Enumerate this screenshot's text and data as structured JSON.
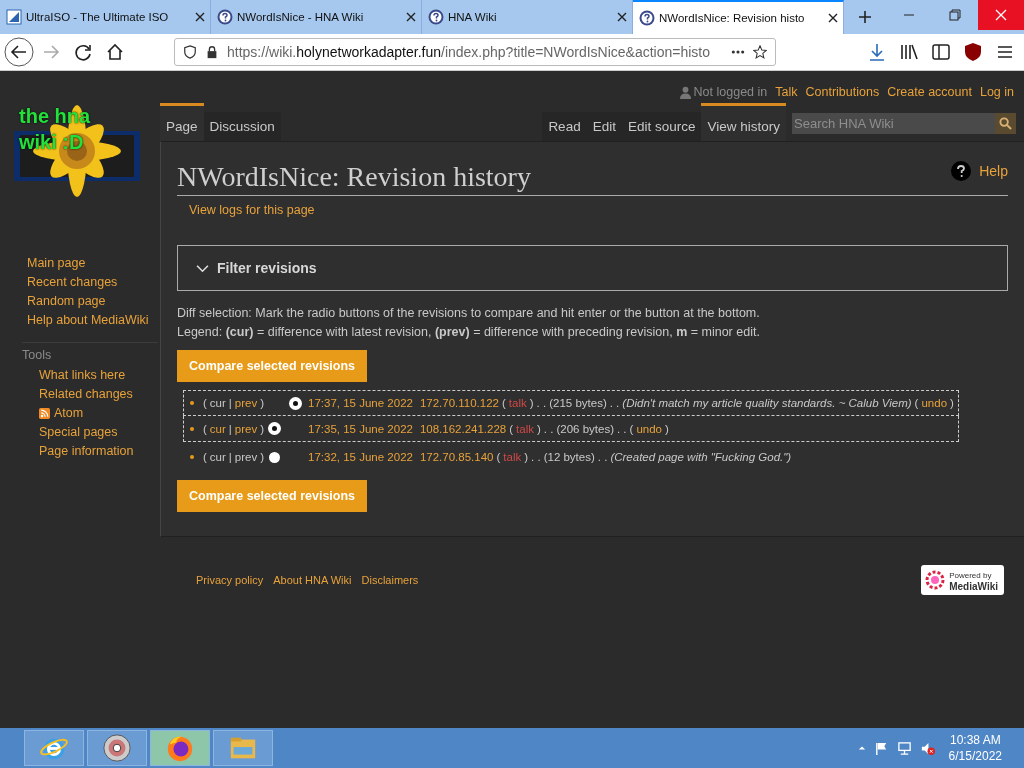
{
  "browser": {
    "tabs": [
      {
        "title": "UltraISO - The Ultimate ISO",
        "kind": "disc-app",
        "selected": false
      },
      {
        "title": "NWordIsNice - HNA Wiki",
        "kind": "wiki",
        "selected": false
      },
      {
        "title": "HNA Wiki",
        "kind": "wiki",
        "selected": false
      },
      {
        "title": "NWordIsNice: Revision histo",
        "kind": "wiki",
        "selected": true
      }
    ],
    "url_prefix": "https://wiki.",
    "url_domain": "holynetworkadapter.fun",
    "url_rest": "/index.php?title=NWordIsNice&action=histo"
  },
  "personal": {
    "status": "Not logged in",
    "links": [
      "Talk",
      "Contributions",
      "Create account",
      "Log in"
    ]
  },
  "logo": {
    "line1": "the hna",
    "line2": "wiki :D"
  },
  "sidebar": {
    "nav": [
      "Main page",
      "Recent changes",
      "Random page",
      "Help about MediaWiki"
    ],
    "tools_heading": "Tools",
    "tools": [
      {
        "label": "What links here",
        "kind": "link"
      },
      {
        "label": "Related changes",
        "kind": "link"
      },
      {
        "label": "Atom",
        "kind": "feed"
      },
      {
        "label": "Special pages",
        "kind": "link"
      },
      {
        "label": "Page information",
        "kind": "link"
      }
    ]
  },
  "namespace_tabs": [
    {
      "label": "Page",
      "selected": true
    },
    {
      "label": "Discussion",
      "selected": false
    }
  ],
  "view_tabs": [
    {
      "label": "Read",
      "selected": false
    },
    {
      "label": "Edit",
      "selected": false
    },
    {
      "label": "Edit source",
      "selected": false
    },
    {
      "label": "View history",
      "selected": true
    }
  ],
  "search": {
    "placeholder": "Search HNA Wiki"
  },
  "title": "NWordIsNice: Revision history",
  "help": "Help",
  "logs_link": "View logs for this page",
  "filter": {
    "label": "Filter revisions",
    "expanded": false
  },
  "intro": "Diff selection: Mark the radio buttons of the revisions to compare and hit enter or the button at the bottom.",
  "legend": "Legend: **(cur)** = difference with latest revision, **(prev)** = difference with preceding revision, **m** = minor edit.",
  "compare_button_top": "Compare selected revisions",
  "revisions": [
    {
      "in_range": true,
      "segments": [
        {
          "kind": "punct",
          "text": "("
        },
        {
          "kind": "plain",
          "text": "cur"
        },
        {
          "kind": "punct",
          "text": "|"
        },
        {
          "kind": "link",
          "text": "prev"
        },
        {
          "kind": "punct",
          "text": ")"
        },
        {
          "kind": "radio_gap"
        },
        {
          "kind": "radio",
          "selected": true
        },
        {
          "kind": "date",
          "text": "17:37, 15 June 2022"
        },
        {
          "kind": "user",
          "text": "172.70.110.122"
        },
        {
          "kind": "punct",
          "text": "("
        },
        {
          "kind": "talk",
          "text": "talk"
        },
        {
          "kind": "punct",
          "text": ")"
        },
        {
          "kind": "punct",
          "text": ". ."
        },
        {
          "kind": "plain",
          "text": "(215 bytes)"
        },
        {
          "kind": "punct",
          "text": ". ."
        },
        {
          "kind": "summary",
          "text": "(Didn't match my article quality standards. ~ Calub Viem)"
        },
        {
          "kind": "punct",
          "text": "("
        },
        {
          "kind": "link",
          "text": "undo"
        },
        {
          "kind": "punct",
          "text": ")"
        }
      ]
    },
    {
      "in_range": true,
      "segments": [
        {
          "kind": "punct",
          "text": "("
        },
        {
          "kind": "link",
          "text": "cur"
        },
        {
          "kind": "punct",
          "text": "|"
        },
        {
          "kind": "link",
          "text": "prev"
        },
        {
          "kind": "punct",
          "text": ")"
        },
        {
          "kind": "radio",
          "selected": true
        },
        {
          "kind": "radio_gap"
        },
        {
          "kind": "date",
          "text": "17:35, 15 June 2022"
        },
        {
          "kind": "user",
          "text": "108.162.241.228"
        },
        {
          "kind": "punct",
          "text": "("
        },
        {
          "kind": "talk",
          "text": "talk"
        },
        {
          "kind": "punct",
          "text": ")"
        },
        {
          "kind": "punct",
          "text": ". ."
        },
        {
          "kind": "plain",
          "text": "(206 bytes)"
        },
        {
          "kind": "punct",
          "text": ". ."
        },
        {
          "kind": "punct",
          "text": "("
        },
        {
          "kind": "link",
          "text": "undo"
        },
        {
          "kind": "punct",
          "text": ")"
        }
      ]
    },
    {
      "in_range": false,
      "segments": [
        {
          "kind": "punct",
          "text": "("
        },
        {
          "kind": "plain",
          "text": "cur"
        },
        {
          "kind": "punct",
          "text": "|"
        },
        {
          "kind": "plain",
          "text": "prev"
        },
        {
          "kind": "punct",
          "text": ")"
        },
        {
          "kind": "radio",
          "selected": false
        },
        {
          "kind": "radio_gap"
        },
        {
          "kind": "date",
          "text": "17:32, 15 June 2022"
        },
        {
          "kind": "user",
          "text": "172.70.85.140"
        },
        {
          "kind": "punct",
          "text": "("
        },
        {
          "kind": "talk",
          "text": "talk"
        },
        {
          "kind": "punct",
          "text": ")"
        },
        {
          "kind": "punct",
          "text": ". ."
        },
        {
          "kind": "plain",
          "text": "(12 bytes)"
        },
        {
          "kind": "punct",
          "text": ". ."
        },
        {
          "kind": "summary",
          "text": "(Created page with \"Fucking God.\")"
        }
      ]
    }
  ],
  "compare_button_bottom": "Compare selected revisions",
  "footer": {
    "links": [
      "Privacy policy",
      "About HNA Wiki",
      "Disclaimers"
    ],
    "badge_top": "Powered by",
    "badge_bottom": "MediaWiki"
  },
  "taskbar": {
    "apps": [
      {
        "kind": "ie",
        "selected": false
      },
      {
        "kind": "disc",
        "selected": false
      },
      {
        "kind": "firefox",
        "selected": true
      },
      {
        "kind": "folder",
        "selected": false
      }
    ],
    "time": "10:38 AM",
    "date": "6/15/2022"
  }
}
